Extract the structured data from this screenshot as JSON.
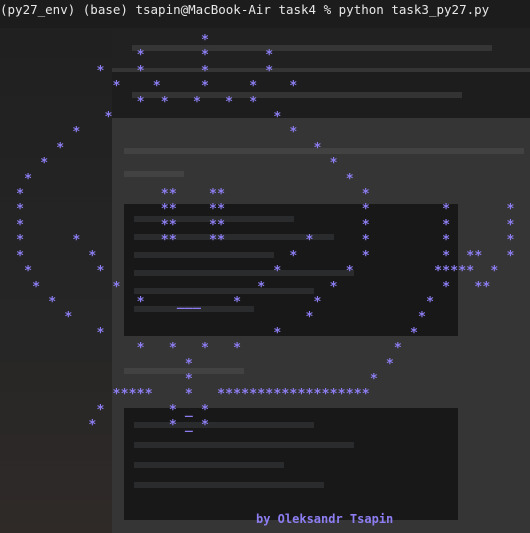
{
  "terminal": {
    "prompt_line": "(py27_env) (base) tsapin@MacBook-Air task4 % python task3_py27.py",
    "ascii_art": [
      "                         *",
      "                 *       *       *",
      "            *    *       *       *",
      "              *    *     *     *    *",
      "                 *  *   *   *  *",
      "             *                    *",
      "         *                          *",
      "       *                               *",
      "     *                                   *",
      "   *                                       *",
      "  *                 **    **                 *",
      "  *                 **    **                 *         *       *",
      "  *                 **    **                 *         *       *",
      "  *      *          **    **          *      *         *       *",
      "  *        *                        *        *         *  **   *",
      "   *        *                     *        *          *****  *",
      "    *         *                 *        *             *   **",
      "      *          *    ___    *         *             *",
      "        *                             *             *",
      "            *                     *                *",
      "                 *   *   *   *                   *",
      "                       *                        *",
      "                       *                      *",
      "              *****    *   *******************",
      "            *        * _ *",
      "           *         * _ *"
    ],
    "credit": "by Oleksandr Tsapin"
  },
  "colors": {
    "background": "#1c1c1c",
    "prompt_text": "#e8e8e8",
    "art_text": "#8c7ef2"
  }
}
